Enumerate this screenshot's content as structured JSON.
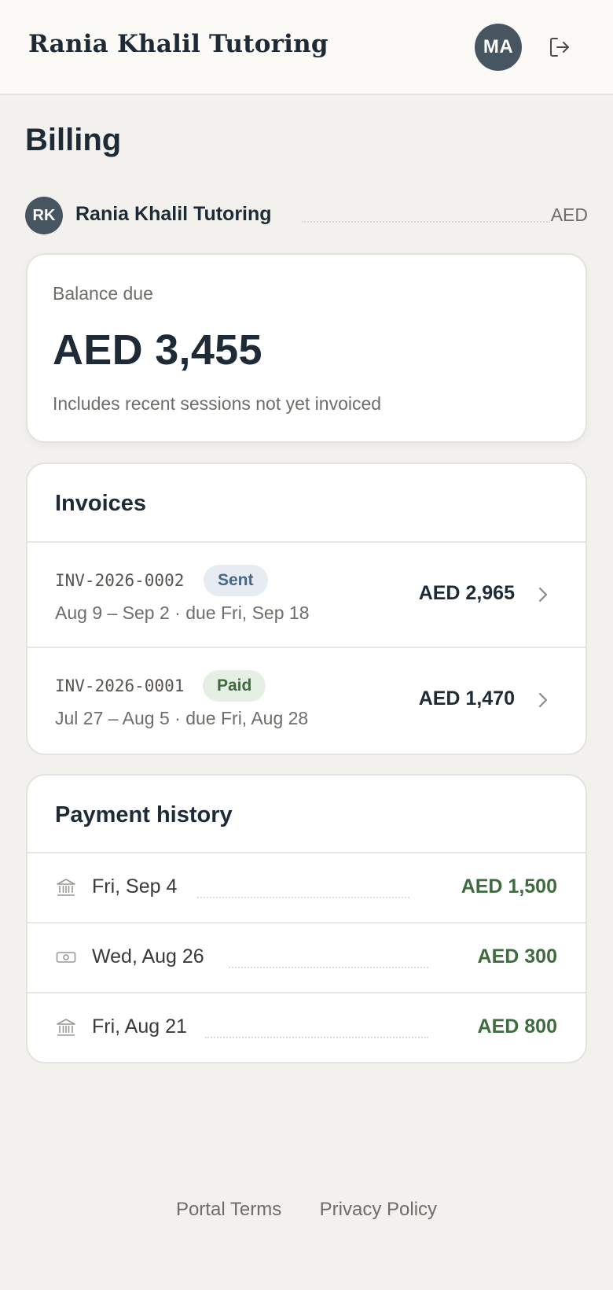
{
  "header": {
    "brand": "Rania Khalil Tutoring",
    "user_initials": "MA",
    "logout_icon": "logout-icon"
  },
  "page": {
    "title": "Billing"
  },
  "account": {
    "initials": "RK",
    "name": "Rania Khalil Tutoring",
    "currency": "AED"
  },
  "balance": {
    "label": "Balance due",
    "amount": "AED 3,455",
    "note": "Includes recent sessions not yet invoiced"
  },
  "invoices": {
    "title": "Invoices",
    "items": [
      {
        "id": "INV-2026-0002",
        "status": "Sent",
        "dates": "Aug 9 – Sep 2 · due Fri, Sep 18",
        "amount": "AED 2,965"
      },
      {
        "id": "INV-2026-0001",
        "status": "Paid",
        "dates": "Jul 27 – Aug 5 · due Fri, Aug 28",
        "amount": "AED 1,470"
      }
    ]
  },
  "payments": {
    "title": "Payment history",
    "items": [
      {
        "date": "Fri, Sep 4",
        "amount": "AED 1,500",
        "icon": "bank-icon"
      },
      {
        "date": "Wed, Aug 26",
        "amount": "AED 300",
        "icon": "cash-icon"
      },
      {
        "date": "Fri, Aug 21",
        "amount": "AED 800",
        "icon": "bank-icon"
      }
    ]
  },
  "footer": {
    "terms": "Portal Terms",
    "privacy": "Privacy Policy"
  },
  "colors": {
    "background": "#f2f1ed",
    "ink": "#1e2a36",
    "avatar": "#475561",
    "paid_green": "#3f6c3e",
    "sent_blue": "#456887"
  }
}
